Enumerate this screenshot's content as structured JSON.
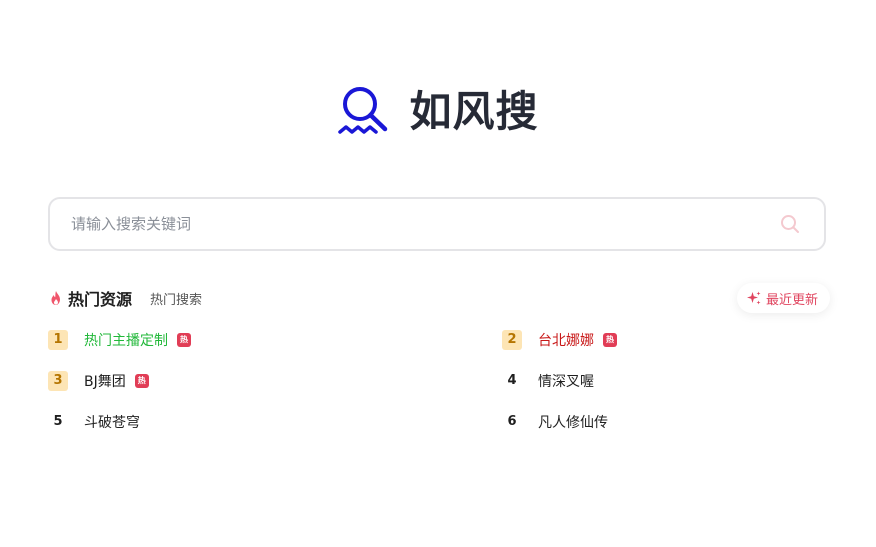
{
  "brand": {
    "title": "如风搜",
    "logo_icon": "magnifier-wave-icon",
    "logo_color": "#1a17d6"
  },
  "search": {
    "placeholder": "请输入搜索关键词",
    "value": "",
    "button_icon": "search-icon"
  },
  "hot": {
    "title": "热门资源",
    "title_icon": "fire-icon",
    "tab": "热门搜索",
    "recent_label": "最近更新",
    "recent_icon": "sparkle-icon",
    "badge_label": "热",
    "items": [
      {
        "rank": "1",
        "text": "热门主播定制",
        "hot": true,
        "color": "#22b83a"
      },
      {
        "rank": "2",
        "text": "台北娜娜",
        "hot": true,
        "color": "#c81818"
      },
      {
        "rank": "3",
        "text": "BJ舞团",
        "hot": true,
        "color": "#1f1f1f"
      },
      {
        "rank": "4",
        "text": "情深叉喔",
        "hot": false,
        "color": "#1f1f1f"
      },
      {
        "rank": "5",
        "text": "斗破苍穹",
        "hot": false,
        "color": "#1f1f1f"
      },
      {
        "rank": "6",
        "text": "凡人修仙传",
        "hot": false,
        "color": "#1f1f1f"
      }
    ]
  },
  "colors": {
    "accent": "#e0455f",
    "rank_top_bg": "#fde5b5",
    "badge_bg": "#e13d56"
  }
}
